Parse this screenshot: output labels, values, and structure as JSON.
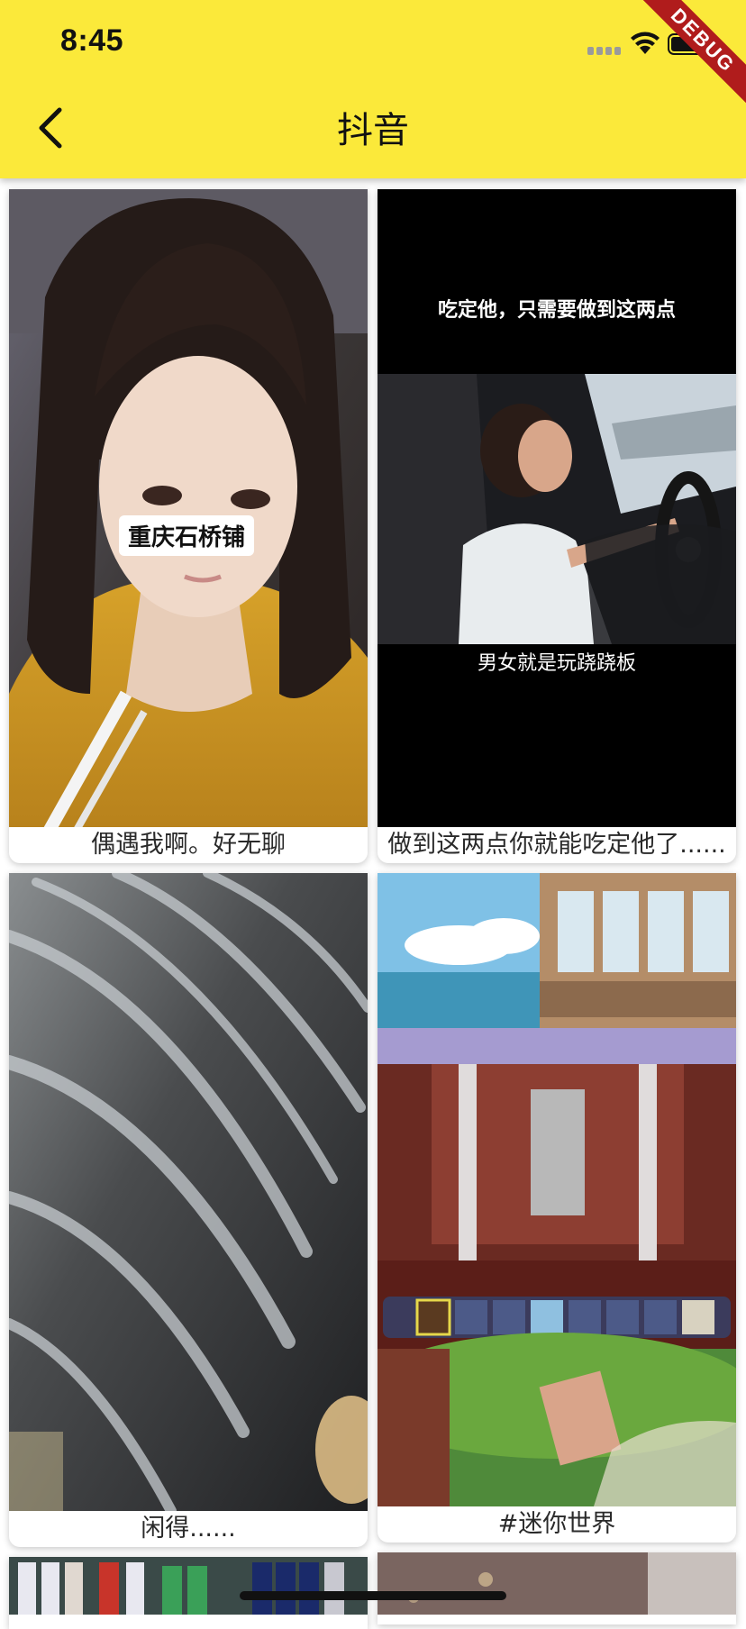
{
  "status_bar": {
    "time": "8:45",
    "signal_icon": "signal-dots-icon",
    "wifi_icon": "wifi-icon",
    "battery_icon": "battery-icon"
  },
  "debug_banner": "DEBUG",
  "app_bar": {
    "title": "抖音",
    "back_icon": "chevron-left-icon",
    "background": "#fbe93a"
  },
  "videos": [
    {
      "caption": "偶遇我啊。好无聊",
      "overlay_text": "重庆石桥铺"
    },
    {
      "caption": "做到这两点你就能吃定他了......",
      "headline": "吃定他，只需要做到这两点",
      "subtitle": "男女就是玩跷跷板"
    },
    {
      "caption": "闲得......"
    },
    {
      "caption": "#迷你世界"
    }
  ]
}
